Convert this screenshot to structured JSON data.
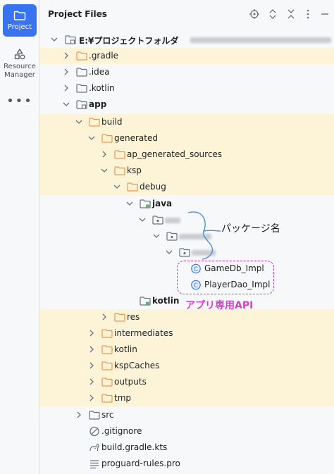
{
  "rail": {
    "project_label": "Project",
    "resource_label": "Resource Manager",
    "more_label": "•••"
  },
  "header": {
    "title": "Project Files"
  },
  "tree": [
    {
      "label": "E:¥プロジェクトフォルダ",
      "icon": "module-folder"
    },
    {
      "label": ".gradle",
      "icon": "folder-orange"
    },
    {
      "label": ".idea",
      "icon": "folder"
    },
    {
      "label": ".kotlin",
      "icon": "folder"
    },
    {
      "label": "app",
      "icon": "module-folder"
    },
    {
      "label": "build",
      "icon": "folder-orange"
    },
    {
      "label": "generated",
      "icon": "folder-orange"
    },
    {
      "label": "ap_generated_sources",
      "icon": "folder-orange"
    },
    {
      "label": "ksp",
      "icon": "folder-orange"
    },
    {
      "label": "debug",
      "icon": "folder-orange"
    },
    {
      "label": "java",
      "icon": "source-folder"
    },
    {
      "label": "",
      "icon": "package"
    },
    {
      "label": "",
      "icon": "package"
    },
    {
      "label": "",
      "icon": "package"
    },
    {
      "label": "GameDb_Impl",
      "icon": "kotlin-class"
    },
    {
      "label": "PlayerDao_Impl",
      "icon": "kotlin-class"
    },
    {
      "label": "kotlin",
      "icon": "source-folder"
    },
    {
      "label": "res",
      "icon": "folder-orange"
    },
    {
      "label": "intermediates",
      "icon": "folder-orange"
    },
    {
      "label": "kotlin",
      "icon": "folder-orange"
    },
    {
      "label": "kspCaches",
      "icon": "folder-orange"
    },
    {
      "label": "outputs",
      "icon": "folder-orange"
    },
    {
      "label": "tmp",
      "icon": "folder-orange"
    },
    {
      "label": "src",
      "icon": "folder"
    },
    {
      "label": ".gitignore",
      "icon": "ignore"
    },
    {
      "label": "build.gradle.kts",
      "icon": "gradle"
    },
    {
      "label": "proguard-rules.pro",
      "icon": "text-file"
    }
  ],
  "annotations": {
    "package_name": "パッケージ名",
    "app_api": "アプリ専用API"
  },
  "colors": {
    "accent": "#3874f2",
    "highlight_row": "#fdf4d8",
    "folder_orange": "#e8964d",
    "annotation_magenta": "#e03ad0"
  }
}
